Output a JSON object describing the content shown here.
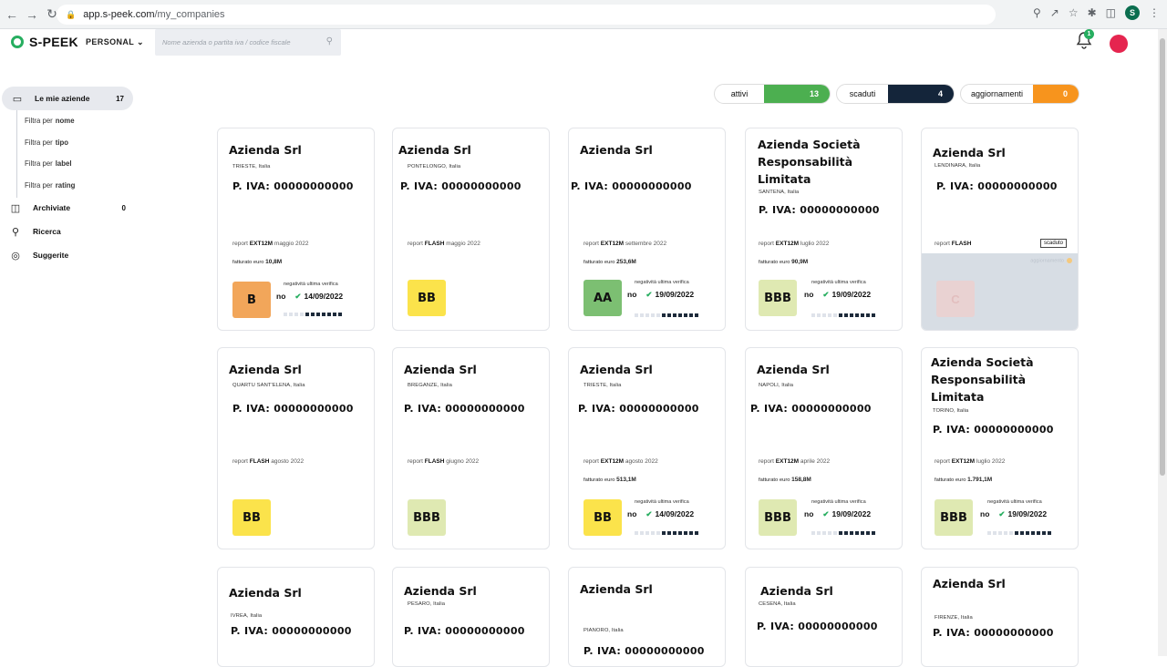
{
  "browser": {
    "url_host": "app.s-peek.com",
    "url_path": "/my_companies",
    "profile_initial": "S"
  },
  "app": {
    "brand": "S-PEEK",
    "workspace": "PERSONAL",
    "search_placeholder": "Nome azienda o partita iva / codice fiscale",
    "notifications": "1"
  },
  "sidebar": {
    "main": {
      "label": "Le mie aziende",
      "count": "17"
    },
    "filters": [
      {
        "prefix": "Filtra per",
        "key": "nome"
      },
      {
        "prefix": "Filtra per",
        "key": "tipo"
      },
      {
        "prefix": "Filtra per",
        "key": "label"
      },
      {
        "prefix": "Filtra per",
        "key": "rating"
      }
    ],
    "archived": {
      "label": "Archiviate",
      "count": "0"
    },
    "search": {
      "label": "Ricerca"
    },
    "suggested": {
      "label": "Suggerite"
    }
  },
  "stats": {
    "active": {
      "label": "attivi",
      "value": "13",
      "color": "#4caf50"
    },
    "expired": {
      "label": "scaduti",
      "value": "4",
      "color": "#14253a"
    },
    "updates": {
      "label": "aggiornamenti",
      "value": "0",
      "color": "#f7941d"
    }
  },
  "colors": {
    "rating_B": "#f2a65a",
    "rating_BB": "#fbe34b",
    "rating_AA": "#7cbf72",
    "rating_BBB": "#dfe9b2"
  },
  "cards": [
    {
      "name": "Azienda Srl",
      "city": "TRIESTE, Italia",
      "vat": "P. IVA: 00000000000",
      "report_prefix": "report",
      "report_type": "EXT12M",
      "report_date": "maggio 2022",
      "turnover_prefix": "fatturato euro",
      "turnover": "10,8M",
      "rating": "B",
      "neg_label": "negatività ultima verifica",
      "neg_value": "no",
      "neg_date": "14/09/2022"
    },
    {
      "name": "Azienda Srl",
      "city": "PONTELONGO, Italia",
      "vat": "P. IVA: 00000000000",
      "report_prefix": "report",
      "report_type": "FLASH",
      "report_date": "maggio 2022",
      "rating": "BB"
    },
    {
      "name": "Azienda Srl",
      "city": "",
      "vat": "P. IVA: 00000000000",
      "report_prefix": "report",
      "report_type": "EXT12M",
      "report_date": "settembre 2022",
      "turnover_prefix": "fatturato euro",
      "turnover": "253,6M",
      "rating": "AA",
      "neg_label": "negatività ultima verifica",
      "neg_value": "no",
      "neg_date": "19/09/2022"
    },
    {
      "name": "Azienda Società Responsabilità Limitata",
      "city": "SANTENA, Italia",
      "vat": "P. IVA: 00000000000",
      "report_prefix": "report",
      "report_type": "EXT12M",
      "report_date": "luglio 2022",
      "turnover_prefix": "fatturato euro",
      "turnover": "90,9M",
      "rating": "BBB",
      "neg_label": "negatività ultima verifica",
      "neg_value": "no",
      "neg_date": "19/09/2022"
    },
    {
      "name": "Azienda Srl",
      "city": "LENDINARA, Italia",
      "vat": "P. IVA: 00000000000",
      "report_prefix": "report",
      "report_type": "FLASH",
      "report_date": "",
      "expired": "scaduto",
      "update_label": "aggiornamento",
      "rating": "C"
    },
    {
      "name": "Azienda Srl",
      "city": "QUARTU SANT'ELENA, Italia",
      "vat": "P. IVA: 00000000000",
      "report_prefix": "report",
      "report_type": "FLASH",
      "report_date": "agosto 2022",
      "rating": "BB"
    },
    {
      "name": "Azienda Srl",
      "city": "BREGANZE, Italia",
      "vat": "P. IVA: 00000000000",
      "report_prefix": "report",
      "report_type": "FLASH",
      "report_date": "giugno 2022",
      "rating": "BBB"
    },
    {
      "name": "Azienda Srl",
      "city": "TRIESTE, Italia",
      "vat": "P. IVA: 00000000000",
      "report_prefix": "report",
      "report_type": "EXT12M",
      "report_date": "agosto 2022",
      "turnover_prefix": "fatturato euro",
      "turnover": "513,1M",
      "rating": "BB",
      "neg_label": "negatività ultima verifica",
      "neg_value": "no",
      "neg_date": "14/09/2022"
    },
    {
      "name": "Azienda Srl",
      "city": "NAPOLI, Italia",
      "vat": "P. IVA: 00000000000",
      "report_prefix": "report",
      "report_type": "EXT12M",
      "report_date": "aprile 2022",
      "turnover_prefix": "fatturato euro",
      "turnover": "158,8M",
      "rating": "BBB",
      "neg_label": "negatività ultima verifica",
      "neg_value": "no",
      "neg_date": "19/09/2022"
    },
    {
      "name": "Azienda Società Responsabilità Limitata",
      "city": "TORINO, Italia",
      "vat": "P. IVA: 00000000000",
      "report_prefix": "report",
      "report_type": "EXT12M",
      "report_date": "luglio 2022",
      "turnover_prefix": "fatturato euro",
      "turnover": "1.791,1M",
      "rating": "BBB",
      "neg_label": "negatività ultima verifica",
      "neg_value": "no",
      "neg_date": "19/09/2022"
    },
    {
      "name": "Azienda Srl",
      "city": "IVREA, Italia",
      "vat": "P. IVA: 00000000000"
    },
    {
      "name": "Azienda Srl",
      "city": "PESARO, Italia",
      "vat": "P. IVA: 00000000000"
    },
    {
      "name": "Azienda Srl",
      "city": "PIANORO, Italia",
      "vat": "P. IVA: 00000000000"
    },
    {
      "name": "Azienda Srl",
      "city": "CESENA, Italia",
      "vat": "P. IVA: 00000000000"
    },
    {
      "name": "Azienda Srl",
      "city": "FIRENZE, Italia",
      "vat": "P. IVA: 00000000000"
    }
  ]
}
